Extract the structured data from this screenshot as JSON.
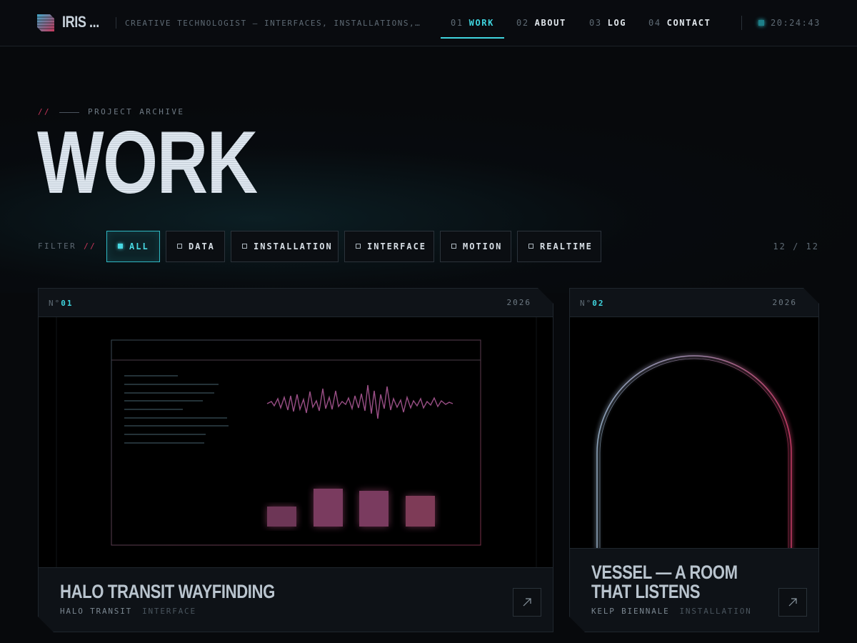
{
  "header": {
    "brand": "IRIS ...",
    "tagline": "CREATIVE TECHNOLOGIST — INTERFACES, INSTALLATIONS, REALTIME SYSTEMS",
    "nav": [
      {
        "num": "01",
        "label": "WORK",
        "active": true
      },
      {
        "num": "02",
        "label": "ABOUT"
      },
      {
        "num": "03",
        "label": "LOG"
      },
      {
        "num": "04",
        "label": "CONTACT"
      }
    ],
    "clock": "20:24:43"
  },
  "hero": {
    "slashes": "//",
    "eyebrow": "PROJECT ARCHIVE",
    "title": "WORK"
  },
  "filter": {
    "label": "FILTER",
    "slashes": "//",
    "chips": [
      "ALL",
      "DATA",
      "INSTALLATION",
      "INTERFACE",
      "MOTION",
      "REALTIME"
    ],
    "active": "ALL",
    "count": "12 / 12"
  },
  "cards": [
    {
      "no_prefix": "N°",
      "no": "01",
      "year": "2026",
      "title": "HALO TRANSIT WAYFINDING",
      "client": "HALO TRANSIT",
      "category": "INTERFACE"
    },
    {
      "no_prefix": "N°",
      "no": "02",
      "year": "2026",
      "title_line1": "VESSEL — A ROOM",
      "title_line2": "THAT LISTENS",
      "client": "KELP BIENNALE",
      "category": "INSTALLATION"
    }
  ],
  "colors": {
    "accent": "#3fd4de",
    "accent_secondary": "#c8365a",
    "background": "#07090c"
  },
  "icons": {
    "logo": "logo-mark-icon",
    "clock": "status-dot-icon",
    "card_link": "arrow-up-right-icon"
  }
}
